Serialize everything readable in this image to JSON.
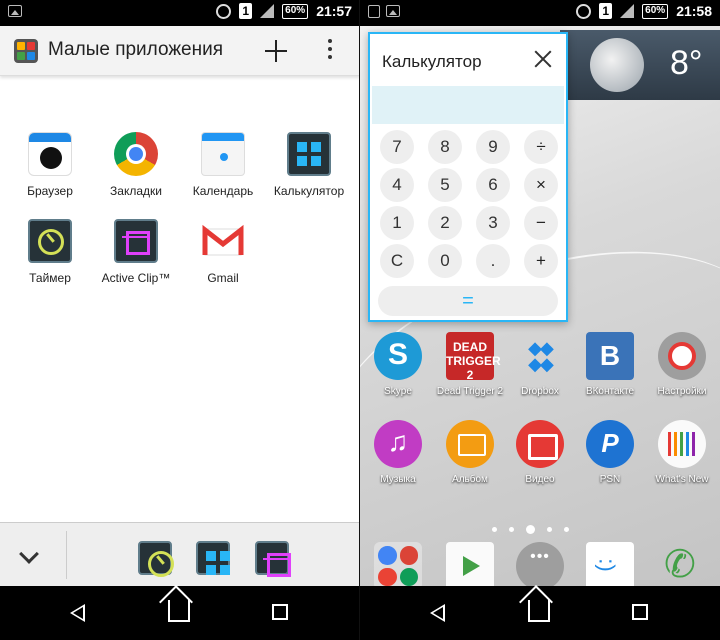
{
  "left": {
    "statusbar": {
      "battery": "60%",
      "time": "21:57",
      "sim": "1"
    },
    "toolbar": {
      "title": "Малые приложения"
    },
    "apps": [
      {
        "label": "Браузер",
        "icon": "browser-icon"
      },
      {
        "label": "Закладки",
        "icon": "chrome-icon"
      },
      {
        "label": "Календарь",
        "icon": "calendar-icon"
      },
      {
        "label": "Калькулятор",
        "icon": "calculator-icon"
      },
      {
        "label": "Таймер",
        "icon": "timer-icon"
      },
      {
        "label": "Active Clip™",
        "icon": "active-clip-icon"
      },
      {
        "label": "Gmail",
        "icon": "gmail-icon"
      }
    ],
    "dock": {
      "icons": [
        "timer-icon",
        "calculator-icon",
        "active-clip-icon"
      ]
    }
  },
  "right": {
    "statusbar": {
      "battery": "60%",
      "time": "21:58",
      "sim": "1"
    },
    "weather": {
      "temperature": "8°"
    },
    "calculator": {
      "title": "Калькулятор",
      "keys": [
        "7",
        "8",
        "9",
        "÷",
        "4",
        "5",
        "6",
        "×",
        "1",
        "2",
        "3",
        "−",
        "C",
        "0",
        ".",
        "+"
      ],
      "equals": "="
    },
    "apps": [
      {
        "label": "Skype",
        "icon": "skype-icon"
      },
      {
        "label": "Dead Trigger 2",
        "icon": "dead-trigger-icon",
        "badge": "DEAD TRIGGER 2"
      },
      {
        "label": "Dropbox",
        "icon": "dropbox-icon"
      },
      {
        "label": "ВКонтакте",
        "icon": "vk-icon"
      },
      {
        "label": "Настройки",
        "icon": "settings-icon"
      },
      {
        "label": "Музыка",
        "icon": "music-icon"
      },
      {
        "label": "Альбом",
        "icon": "album-icon"
      },
      {
        "label": "Видео",
        "icon": "video-icon"
      },
      {
        "label": "PSN",
        "icon": "psn-icon"
      },
      {
        "label": "What's New",
        "icon": "whats-new-icon"
      }
    ],
    "dock": {
      "icons": [
        "google-folder-icon",
        "play-store-icon",
        "app-drawer-icon",
        "messaging-icon",
        "phone-icon"
      ]
    },
    "page_indicator": {
      "pages": 5,
      "current": 3
    }
  },
  "colors": {
    "accent": "#29b6f6",
    "calc_display": "#e0f2f7",
    "skype": "#1e9ad6",
    "vk": "#3a73b8",
    "music": "#c13cc4",
    "album": "#f39c12",
    "video": "#e53935",
    "psn": "#1e73d2"
  }
}
